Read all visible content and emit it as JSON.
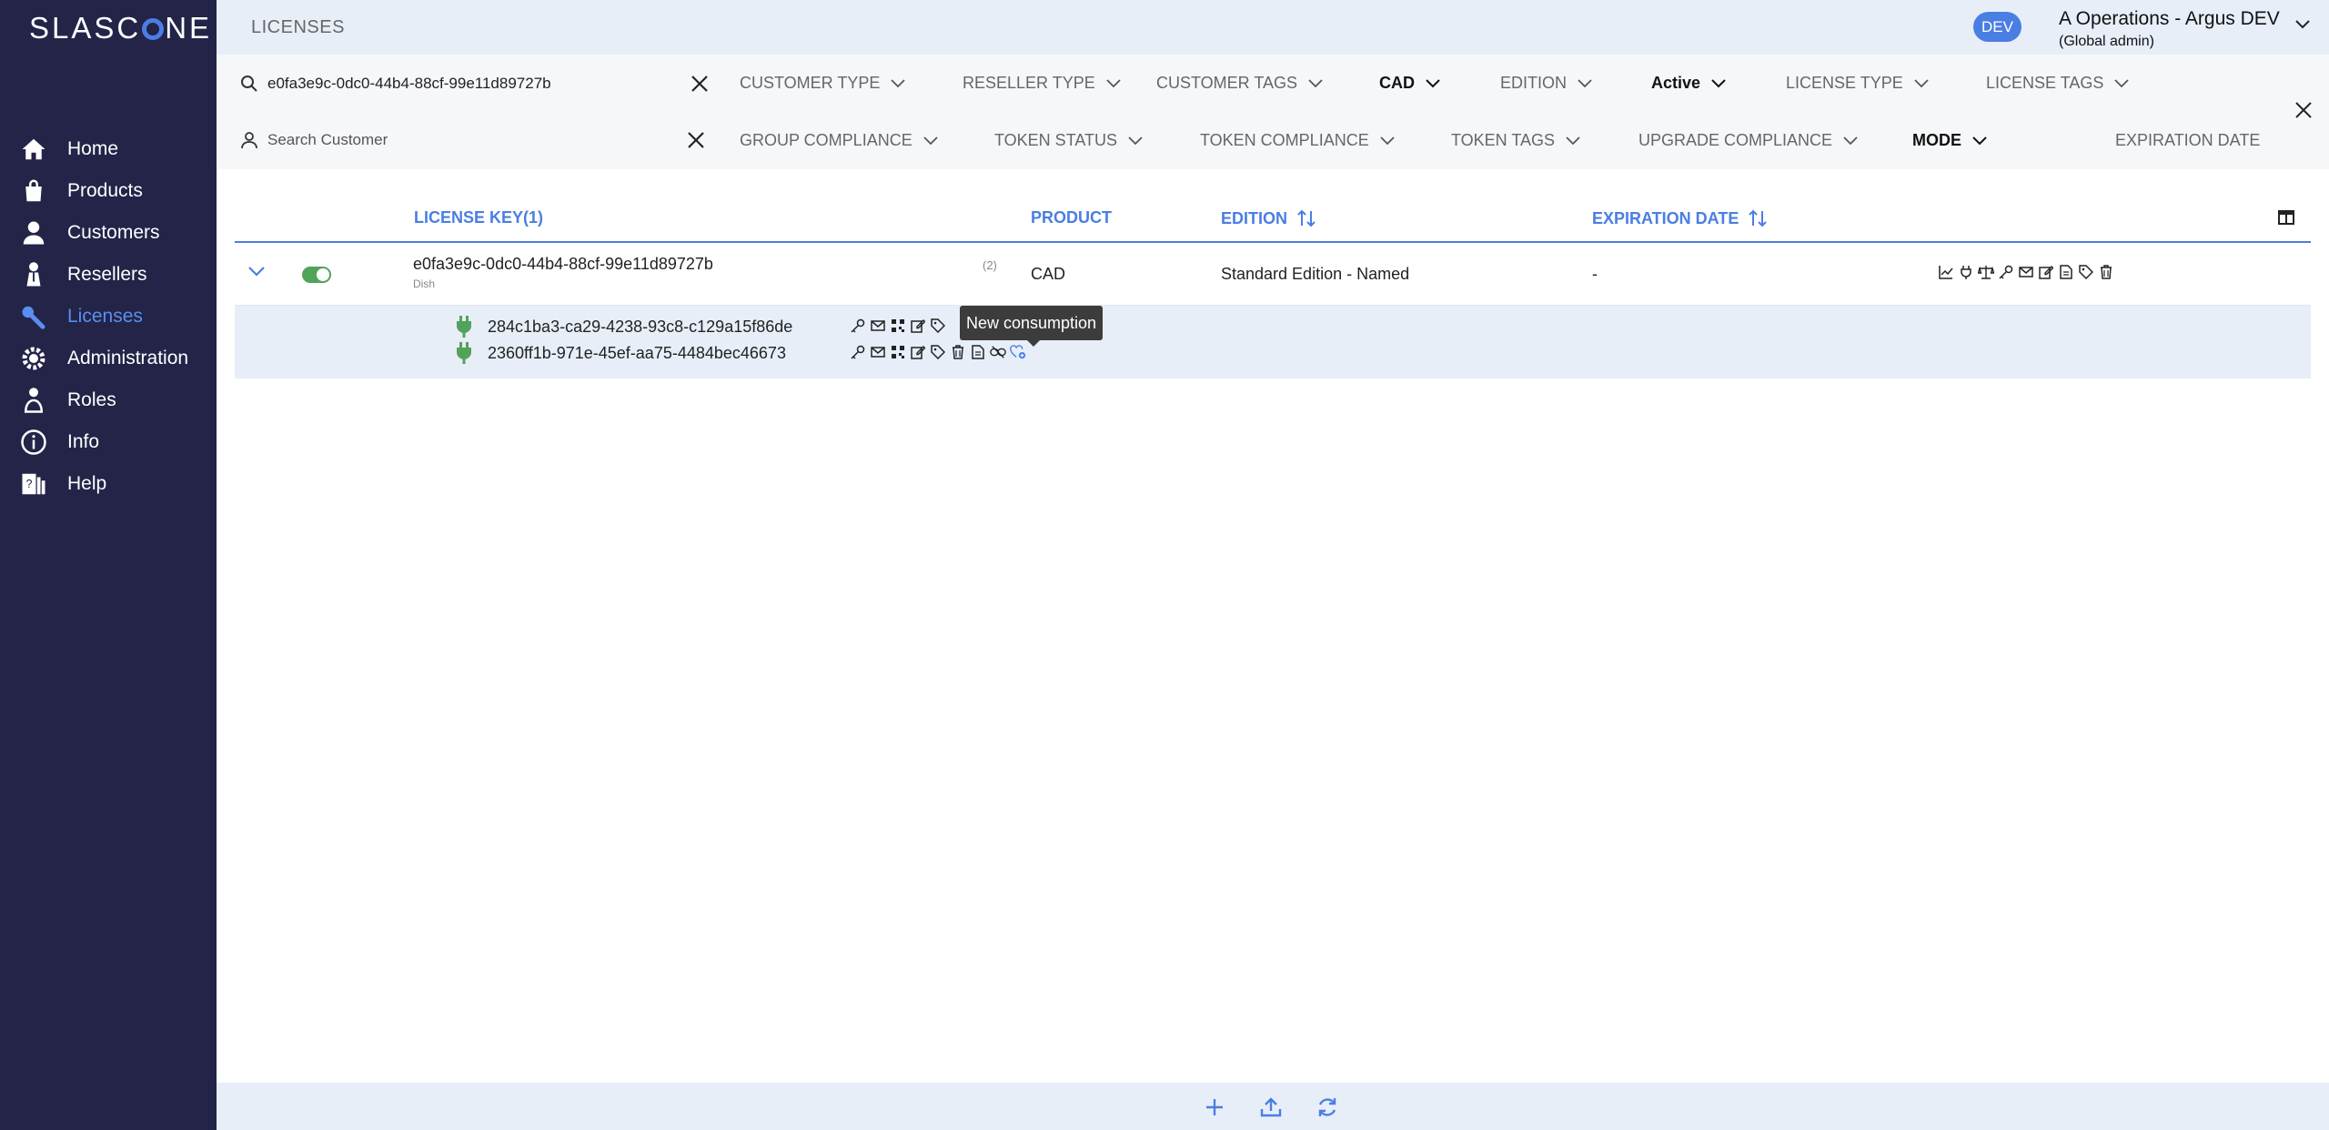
{
  "brand": {
    "name_left": "SLASC",
    "name_right": "NE"
  },
  "nav": [
    {
      "label": "Home",
      "icon": "home-icon"
    },
    {
      "label": "Products",
      "icon": "bag-icon"
    },
    {
      "label": "Customers",
      "icon": "user-icon"
    },
    {
      "label": "Resellers",
      "icon": "reseller-icon"
    },
    {
      "label": "Licenses",
      "icon": "key-icon",
      "active": true
    },
    {
      "label": "Administration",
      "icon": "gear-icon"
    },
    {
      "label": "Roles",
      "icon": "roles-icon"
    },
    {
      "label": "Info",
      "icon": "info-icon"
    },
    {
      "label": "Help",
      "icon": "help-icon"
    }
  ],
  "header": {
    "title": "LICENSES",
    "env_badge": "DEV",
    "account_name": "A Operations - Argus DEV",
    "account_role": "(Global admin)"
  },
  "filters": {
    "license_search": "e0fa3e9c-0dc0-44b4-88cf-99e11d89727b",
    "customer_search_placeholder": "Search Customer",
    "row1": [
      "CUSTOMER TYPE",
      "RESELLER TYPE",
      "CUSTOMER TAGS",
      "CAD",
      "EDITION",
      "Active",
      "LICENSE TYPE",
      "LICENSE TAGS"
    ],
    "row2": [
      "GROUP COMPLIANCE",
      "TOKEN STATUS",
      "TOKEN COMPLIANCE",
      "TOKEN TAGS",
      "UPGRADE COMPLIANCE",
      "MODE",
      "EXPIRATION DATE"
    ]
  },
  "table": {
    "columns": {
      "license_key": "LICENSE KEY(1)",
      "product": "PRODUCT",
      "edition": "EDITION",
      "expiration": "EXPIRATION DATE"
    },
    "row": {
      "license_key": "e0fa3e9c-0dc0-44b4-88cf-99e11d89727b",
      "customer": "Dish",
      "token_count": "(2)",
      "product": "CAD",
      "edition": "Standard Edition - Named",
      "expiration": "-",
      "active": true
    },
    "tokens": [
      {
        "key": "284c1ba3-ca29-4238-93c8-c129a15f86de"
      },
      {
        "key": "2360ff1b-971e-45ef-aa75-4484bec46673"
      }
    ]
  },
  "tooltip": "New consumption",
  "colors": {
    "sidebar": "#232448",
    "accent": "#4a7ee3",
    "active_green": "#52a35a"
  }
}
